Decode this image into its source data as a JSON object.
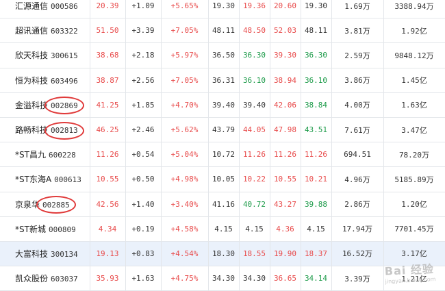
{
  "colors": {
    "up": "#e84a4a",
    "down": "#1b9a48",
    "highlight_row": "#eaf1fb",
    "circle": "#e03a3a"
  },
  "rows": [
    {
      "name": "汇源通信",
      "code": "000586",
      "price": "20.39",
      "change": "+1.09",
      "pct": "+5.65%",
      "prev_close": "19.30",
      "open": "19.36",
      "high": "20.60",
      "low": "19.30",
      "volume": "1.69万",
      "amount": "3388.94万",
      "extra": "",
      "c": {
        "open": "red",
        "high": "red",
        "low": "gray"
      }
    },
    {
      "name": "超讯通信",
      "code": "603322",
      "price": "51.50",
      "change": "+3.39",
      "pct": "+7.05%",
      "prev_close": "48.11",
      "open": "48.50",
      "high": "52.03",
      "low": "48.11",
      "volume": "3.81万",
      "amount": "1.92亿",
      "extra": "",
      "c": {
        "open": "red",
        "high": "red",
        "low": "gray"
      }
    },
    {
      "name": "欣天科技",
      "code": "300615",
      "price": "38.68",
      "change": "+2.18",
      "pct": "+5.97%",
      "prev_close": "36.50",
      "open": "36.30",
      "high": "39.30",
      "low": "36.30",
      "volume": "2.59万",
      "amount": "9848.12万",
      "extra": "",
      "c": {
        "open": "green",
        "high": "red",
        "low": "green"
      }
    },
    {
      "name": "恒为科技",
      "code": "603496",
      "price": "38.87",
      "change": "+2.56",
      "pct": "+7.05%",
      "prev_close": "36.31",
      "open": "36.10",
      "high": "38.94",
      "low": "36.10",
      "volume": "3.86万",
      "amount": "1.45亿",
      "extra": "",
      "c": {
        "open": "green",
        "high": "red",
        "low": "green"
      }
    },
    {
      "name": "金溢科技",
      "code": "002869",
      "price": "41.25",
      "change": "+1.85",
      "pct": "+4.70%",
      "prev_close": "39.40",
      "open": "39.40",
      "high": "42.06",
      "low": "38.84",
      "volume": "4.00万",
      "amount": "1.63亿",
      "extra": "1",
      "c": {
        "open": "gray",
        "high": "red",
        "low": "green"
      }
    },
    {
      "name": "路畅科技",
      "code": "002813",
      "price": "46.25",
      "change": "+2.46",
      "pct": "+5.62%",
      "prev_close": "43.79",
      "open": "44.05",
      "high": "47.98",
      "low": "43.51",
      "volume": "7.61万",
      "amount": "3.47亿",
      "extra": "2",
      "c": {
        "open": "red",
        "high": "red",
        "low": "green"
      }
    },
    {
      "name": "*ST昌九",
      "code": "600228",
      "price": "11.26",
      "change": "+0.54",
      "pct": "+5.04%",
      "prev_close": "10.72",
      "open": "11.26",
      "high": "11.26",
      "low": "11.26",
      "volume": "694.51",
      "amount": "78.20万",
      "extra": "",
      "c": {
        "open": "red",
        "high": "red",
        "low": "red"
      }
    },
    {
      "name": "*ST东海A",
      "code": "000613",
      "price": "10.55",
      "change": "+0.50",
      "pct": "+4.98%",
      "prev_close": "10.05",
      "open": "10.22",
      "high": "10.55",
      "low": "10.21",
      "volume": "4.96万",
      "amount": "5185.89万",
      "extra": "2",
      "c": {
        "open": "red",
        "high": "red",
        "low": "red"
      }
    },
    {
      "name": "京泉华",
      "code": "002885",
      "price": "42.56",
      "change": "+1.40",
      "pct": "+3.40%",
      "prev_close": "41.16",
      "open": "40.72",
      "high": "43.27",
      "low": "39.88",
      "volume": "2.86万",
      "amount": "1.20亿",
      "extra": "1",
      "c": {
        "open": "green",
        "high": "red",
        "low": "green"
      }
    },
    {
      "name": "*ST新城",
      "code": "000809",
      "price": "4.34",
      "change": "+0.19",
      "pct": "+4.58%",
      "prev_close": "4.15",
      "open": "4.15",
      "high": "4.36",
      "low": "4.15",
      "volume": "17.94万",
      "amount": "7701.45万",
      "extra": "",
      "c": {
        "open": "gray",
        "high": "red",
        "low": "gray"
      }
    },
    {
      "name": "大富科技",
      "code": "300134",
      "price": "19.13",
      "change": "+0.83",
      "pct": "+4.54%",
      "prev_close": "18.30",
      "open": "18.55",
      "high": "19.90",
      "low": "18.37",
      "volume": "16.52万",
      "amount": "3.17亿",
      "extra": "2",
      "c": {
        "open": "red",
        "high": "red",
        "low": "red"
      }
    },
    {
      "name": "凯众股份",
      "code": "603037",
      "price": "35.93",
      "change": "+1.63",
      "pct": "+4.75%",
      "prev_close": "34.30",
      "open": "34.30",
      "high": "36.65",
      "low": "34.14",
      "volume": "3.39万",
      "amount": "1.21亿",
      "extra": "",
      "c": {
        "open": "gray",
        "high": "red",
        "low": "green"
      }
    }
  ],
  "highlighted_row": 10,
  "circled_codes": [
    "002869",
    "002813",
    "002885"
  ],
  "watermark": {
    "main": "Bai 经验",
    "sub": "jingyan.baidu.com"
  }
}
